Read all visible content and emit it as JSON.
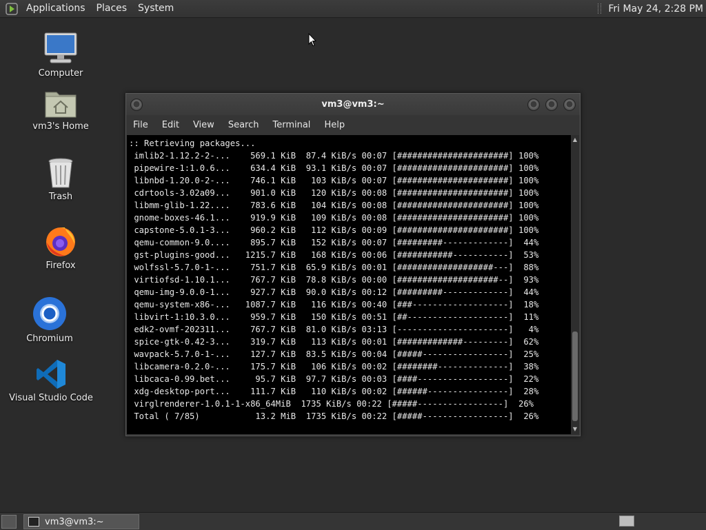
{
  "top_panel": {
    "menus": [
      "Applications",
      "Places",
      "System"
    ],
    "clock": "Fri May 24,  2:28 PM"
  },
  "desktop_icons": [
    {
      "label": "Computer",
      "icon": "computer-icon"
    },
    {
      "label": "vm3's Home",
      "icon": "home-folder-icon"
    },
    {
      "label": "Trash",
      "icon": "trash-icon"
    },
    {
      "label": "Firefox",
      "icon": "firefox-icon"
    },
    {
      "label": "Chromium",
      "icon": "chromium-icon"
    },
    {
      "label": "Visual Studio Code",
      "icon": "vscode-icon"
    }
  ],
  "terminal": {
    "title": "vm3@vm3:~",
    "menu": [
      "File",
      "Edit",
      "View",
      "Search",
      "Terminal",
      "Help"
    ],
    "lines": [
      ":: Retrieving packages...",
      " imlib2-1.12.2-2-...    569.1 KiB  87.4 KiB/s 00:07 [######################] 100%",
      " pipewire-1:1.0.6...    634.4 KiB  93.1 KiB/s 00:07 [######################] 100%",
      " libnbd-1.20.0-2-...    746.1 KiB   103 KiB/s 00:07 [######################] 100%",
      " cdrtools-3.02a09...    901.0 KiB   120 KiB/s 00:08 [######################] 100%",
      " libmm-glib-1.22....    783.6 KiB   104 KiB/s 00:08 [######################] 100%",
      " gnome-boxes-46.1...    919.9 KiB   109 KiB/s 00:08 [######################] 100%",
      " capstone-5.0.1-3...    960.2 KiB   112 KiB/s 00:09 [######################] 100%",
      " qemu-common-9.0....    895.7 KiB   152 KiB/s 00:07 [#########-------------]  44%",
      " gst-plugins-good...   1215.7 KiB   168 KiB/s 00:06 [###########-----------]  53%",
      " wolfssl-5.7.0-1-...    751.7 KiB  65.9 KiB/s 00:01 [###################---]  88%",
      " virtiofsd-1.10.1...    767.7 KiB  78.8 KiB/s 00:00 [####################--]  93%",
      " qemu-img-9.0.0-1...    927.7 KiB  90.0 KiB/s 00:12 [#########-------------]  44%",
      " qemu-system-x86-...   1087.7 KiB   116 KiB/s 00:40 [###-------------------]  18%",
      " libvirt-1:10.3.0...    959.7 KiB   150 KiB/s 00:51 [##--------------------]  11%",
      " edk2-ovmf-202311...    767.7 KiB  81.0 KiB/s 03:13 [----------------------]   4%",
      " spice-gtk-0.42-3...    319.7 KiB   113 KiB/s 00:01 [#############---------]  62%",
      " wavpack-5.7.0-1-...    127.7 KiB  83.5 KiB/s 00:04 [#####-----------------]  25%",
      " libcamera-0.2.0-...    175.7 KiB   106 KiB/s 00:02 [########--------------]  38%",
      " libcaca-0.99.bet...     95.7 KiB  97.7 KiB/s 00:03 [####------------------]  22%",
      " xdg-desktop-port...    111.7 KiB   110 KiB/s 00:02 [######----------------]  28%",
      " virglrenderer-1.0.1-1-x86_64MiB  1735 KiB/s 00:22 [#####-----------------]  26%",
      " Total ( 7/85)           13.2 MiB  1735 KiB/s 00:22 [#####-----------------]  26%"
    ]
  },
  "bottom_panel": {
    "task_label": "vm3@vm3:~"
  }
}
